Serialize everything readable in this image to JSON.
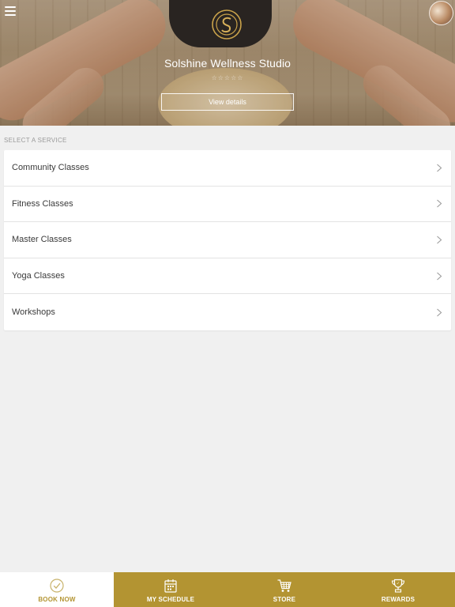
{
  "header": {
    "studio_name": "Solshine Wellness Studio",
    "rating_text": "☆☆☆☆☆",
    "view_details_label": "View details"
  },
  "services": {
    "section_label": "SELECT A SERVICE",
    "items": [
      {
        "label": "Community Classes"
      },
      {
        "label": "Fitness Classes"
      },
      {
        "label": "Master Classes"
      },
      {
        "label": "Yoga Classes"
      },
      {
        "label": "Workshops"
      }
    ]
  },
  "bottom_nav": {
    "items": [
      {
        "label": "BOOK NOW",
        "icon": "check-circle-icon",
        "active": true
      },
      {
        "label": "MY SCHEDULE",
        "icon": "calendar-icon",
        "active": false
      },
      {
        "label": "STORE",
        "icon": "cart-icon",
        "active": false
      },
      {
        "label": "REWARDS",
        "icon": "trophy-icon",
        "active": false
      }
    ]
  },
  "colors": {
    "brand_gold": "#b39432",
    "background": "#f0f0f0",
    "card": "#ffffff"
  }
}
